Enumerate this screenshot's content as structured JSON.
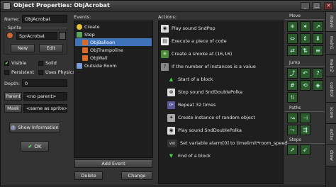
{
  "window": {
    "title": "Object Properties: ObjAcrobat",
    "min": "_",
    "max": "□",
    "close": "✕"
  },
  "left": {
    "name_label": "Name:",
    "name_value": "ObjAcrobat",
    "sprite_label": "Sprite",
    "sprite_value": "SprAcrobat",
    "new_label": "New",
    "edit_label": "Edit",
    "visible_label": "Visible",
    "solid_label": "Solid",
    "persistent_label": "Persistent",
    "uses_physics_label": "Uses Physics",
    "depth_label": "Depth:",
    "depth_value": "0",
    "parent_label": "Parent",
    "parent_value": "<no parent>",
    "mask_label": "Mask",
    "mask_value": "<same as sprite>",
    "show_info_label": "Show Information",
    "ok_label": "OK",
    "visible_checked": true,
    "solid_checked": false,
    "persistent_checked": false,
    "uses_physics_checked": false
  },
  "events": {
    "header": "Events:",
    "items": [
      {
        "label": "Create",
        "icon": "lightbulb-icon",
        "selected": false,
        "indent": 0
      },
      {
        "label": "Step",
        "icon": "step-icon",
        "selected": false,
        "indent": 0
      },
      {
        "label": "ObjBalloon",
        "icon": "collision-icon",
        "selected": true,
        "indent": 1
      },
      {
        "label": "ObjTrampoline",
        "icon": "collision-icon",
        "selected": false,
        "indent": 1
      },
      {
        "label": "ObjWall",
        "icon": "collision-icon",
        "selected": false,
        "indent": 1
      },
      {
        "label": "Outside Room",
        "icon": "outside-room-icon",
        "selected": false,
        "indent": 0
      }
    ],
    "add_event": "Add Event",
    "delete": "Delete",
    "change": "Change"
  },
  "actions": {
    "header": "Actions:",
    "items": [
      {
        "label": "Play sound SndPop",
        "icon": "sound-icon",
        "indent": 0
      },
      {
        "label": "Execute a piece of code",
        "icon": "code-icon",
        "indent": 0
      },
      {
        "label": "Create a smoke at (16,16)",
        "icon": "effect-icon",
        "indent": 0
      },
      {
        "label": "If the number of instances is a value",
        "icon": "test-instances-icon",
        "indent": 0
      },
      {
        "label": "Start of a block",
        "icon": "start-block-icon",
        "indent": 1
      },
      {
        "label": "Stop sound SndDoublePolka",
        "icon": "stop-sound-icon",
        "indent": 1
      },
      {
        "label": "Repeat 32 times",
        "icon": "repeat-icon",
        "indent": 1
      },
      {
        "label": "Create instance of random object",
        "icon": "create-random-icon",
        "indent": 1
      },
      {
        "label": "Play sound SndDoublePolka",
        "icon": "sound-icon",
        "indent": 1
      },
      {
        "label": "Set variable alarm[0] to timelimit*room_speed",
        "icon": "var-icon",
        "indent": 1
      },
      {
        "label": "End of a block",
        "icon": "end-block-icon",
        "indent": 1
      }
    ]
  },
  "tabs": [
    "move",
    "main1",
    "main2",
    "control",
    "score",
    "extra",
    "draw"
  ],
  "sections": {
    "move": "Move",
    "jump": "Jump",
    "paths": "Paths",
    "steps": "Steps"
  }
}
